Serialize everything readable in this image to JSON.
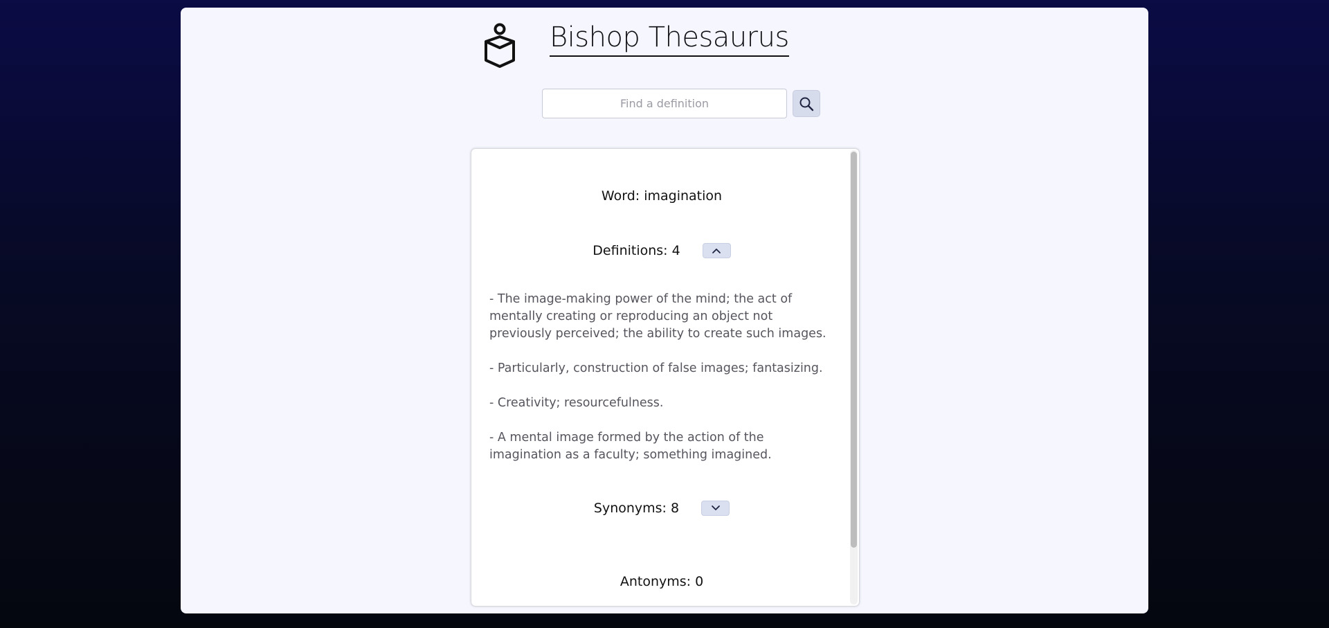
{
  "header": {
    "title": "Bishop Thesaurus",
    "logo_icon": "reading-person-icon"
  },
  "search": {
    "placeholder": "Find a definition",
    "value": "",
    "button_icon": "search-icon"
  },
  "result": {
    "word_text": "Word: imagination",
    "definitions_label": "Definitions: 4",
    "definitions_toggle_icon": "chevron-up-icon",
    "definitions": [
      "- The image-making power of the mind; the act of mentally creating or reproducing an object not previously perceived; the ability to create such images.",
      "- Particularly, construction of false images; fantasizing.",
      "- Creativity; resourcefulness.",
      "- A mental image formed by the action of the imagination as a faculty; something imagined."
    ],
    "synonyms_label": "Synonyms: 8",
    "synonyms_toggle_icon": "chevron-down-icon",
    "antonyms_label": "Antonyms: 0"
  },
  "colors": {
    "background_top": "#0b0b45",
    "background_bottom": "#05070f",
    "panel": "#f5f6fe",
    "button": "#d7dcec"
  }
}
